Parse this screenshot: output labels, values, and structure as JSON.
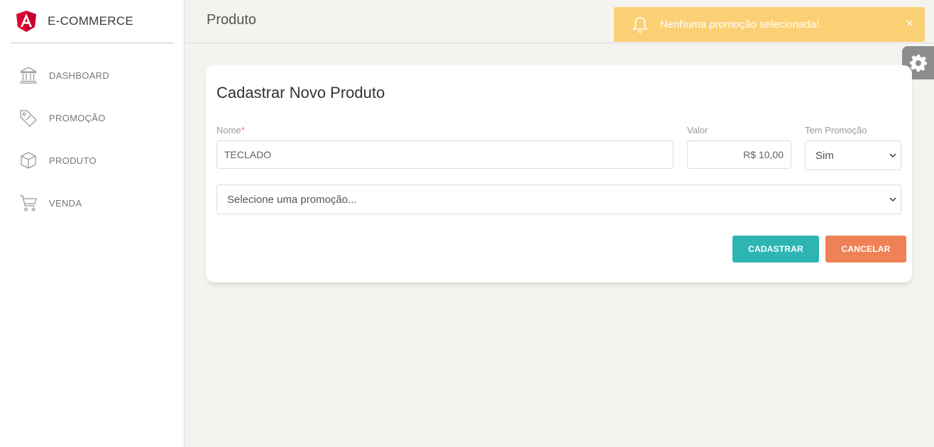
{
  "brand": {
    "name": "E-COMMERCE"
  },
  "sidebar": {
    "items": [
      {
        "label": "DASHBOARD",
        "icon": "bank-icon"
      },
      {
        "label": "PROMOÇÃO",
        "icon": "tag-icon"
      },
      {
        "label": "PRODUTO",
        "icon": "box-icon"
      },
      {
        "label": "VENDA",
        "icon": "cart-icon"
      }
    ]
  },
  "header": {
    "title": "Produto"
  },
  "toast": {
    "message": "Nenhuma promoção selecionada!.",
    "close": "×",
    "color": "#fbd074"
  },
  "form": {
    "title": "Cadastrar Novo Produto",
    "nome": {
      "label": "Nome",
      "required_mark": "*",
      "value": "TECLADO"
    },
    "valor": {
      "label": "Valor",
      "value": "R$ 10,00"
    },
    "tem_promocao": {
      "label": "Tem Promoção",
      "value": "Sim"
    },
    "promocao": {
      "placeholder": "Selecione uma promoção..."
    },
    "buttons": {
      "submit": "CADASTRAR",
      "cancel": "CANCELAR"
    }
  },
  "colors": {
    "primary": "#2eb5b3",
    "danger": "#ef8157",
    "warning": "#fbd074"
  }
}
